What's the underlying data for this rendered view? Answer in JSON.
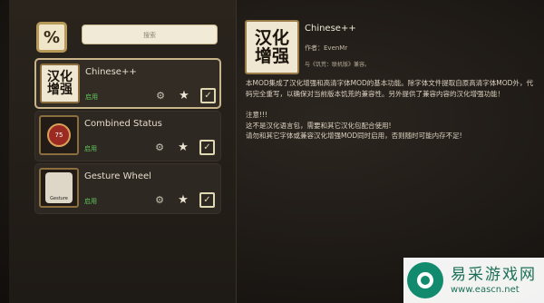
{
  "search": {
    "placeholder": "搜索"
  },
  "mods": [
    {
      "name": "Chinese++",
      "status": "启用",
      "thumb_text": "汉化增强"
    },
    {
      "name": "Combined Status",
      "status": "启用",
      "thumb_text": "75"
    },
    {
      "name": "Gesture Wheel",
      "status": "启用",
      "thumb_text": "Gesture"
    }
  ],
  "detail": {
    "thumb_text": "汉化增强",
    "title": "Chinese++",
    "author": "作者：EvenMr",
    "subtitle": "与《饥荒：联机版》兼容。",
    "description": [
      "本MOD集成了汉化增强和高清字体MOD的基本功能。除字体文件提取自原高清字体MOD外，代码完全重写，以确保对当前版本饥荒的兼容性。另外提供了兼容内容的汉化增强功能！",
      "",
      "注意!!!",
      "这不是汉化语言包，需要和其它汉化包配合使用!",
      "请勿和其它字体或兼容汉化增强MOD同时启用，否则随时可能内存不足!"
    ]
  },
  "watermark": {
    "name": "易采游戏网",
    "url": "www.eascn.net"
  },
  "colors": {
    "enabled": "#5ec95a",
    "accent": "#c9b48a"
  },
  "icons": [
    "filter-icon",
    "wrench-icon",
    "star-icon",
    "checkbox-icon"
  ]
}
